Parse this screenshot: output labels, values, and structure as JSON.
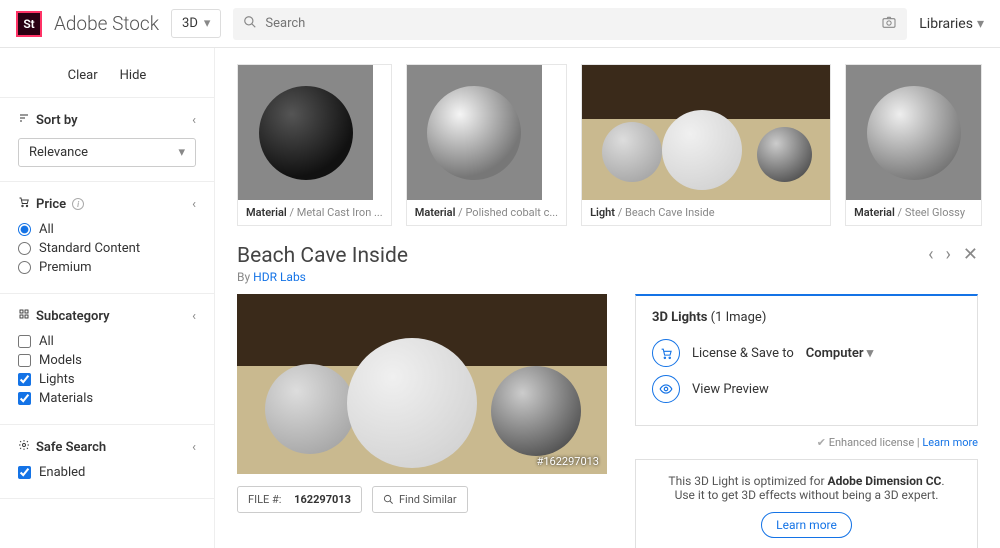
{
  "header": {
    "brand": "Adobe Stock",
    "category": "3D",
    "search_placeholder": "Search",
    "libraries": "Libraries"
  },
  "sidebar": {
    "clear": "Clear",
    "hide": "Hide",
    "sort_by_label": "Sort by",
    "sort_value": "Relevance",
    "price_label": "Price",
    "price_options": {
      "all": "All",
      "standard": "Standard Content",
      "premium": "Premium"
    },
    "subcategory_label": "Subcategory",
    "sub_options": {
      "all": "All",
      "models": "Models",
      "lights": "Lights",
      "materials": "Materials"
    },
    "safe_search_label": "Safe Search",
    "enabled": "Enabled"
  },
  "thumbs": [
    {
      "kind": "Material",
      "name": "Metal Cast Iron ..."
    },
    {
      "kind": "Material",
      "name": "Polished cobalt c..."
    },
    {
      "kind": "Light",
      "name": "Beach Cave Inside"
    },
    {
      "kind": "Material",
      "name": "Steel Glossy"
    }
  ],
  "detail": {
    "title": "Beach Cave Inside",
    "by": "By ",
    "author": "HDR Labs",
    "watermark": "#162297013",
    "file_label": "FILE #:",
    "file_no": "162297013",
    "find_similar": "Find Similar"
  },
  "panel": {
    "group": "3D Lights",
    "count": "(1 Image)",
    "license": "License & Save to",
    "dest": "Computer",
    "view_preview": "View Preview",
    "enhanced": "Enhanced license",
    "learn_more": "Learn more"
  },
  "promo": {
    "line1a": "This 3D Light is optimized for ",
    "line1b": "Adobe Dimension CC",
    "line2": "Use it to get 3D effects without being a 3D expert.",
    "cta": "Learn more"
  }
}
